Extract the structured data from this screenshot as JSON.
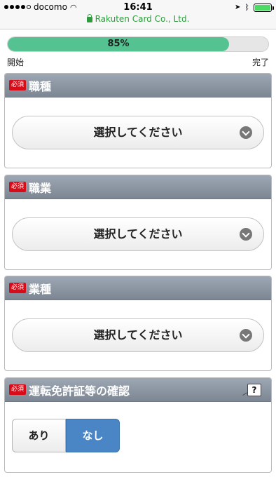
{
  "statusbar": {
    "carrier": "docomo",
    "time": "16:41"
  },
  "urlbar": {
    "site": "Rakuten Card Co., Ltd."
  },
  "progress": {
    "value": 85,
    "label": "85%",
    "start_label": "開始",
    "end_label": "完了"
  },
  "sections": [
    {
      "badge": "必須",
      "title": "職種",
      "select_label": "選択してください"
    },
    {
      "badge": "必須",
      "title": "職業",
      "select_label": "選択してください"
    },
    {
      "badge": "必須",
      "title": "業種",
      "select_label": "選択してください"
    },
    {
      "badge": "必須",
      "title": "運転免許証等の確認",
      "help_text": "?",
      "options": [
        "あり",
        "なし"
      ],
      "selected": "なし"
    }
  ],
  "colors": {
    "progress_fill": "#54c291",
    "badge": "#d80c18",
    "header": "#8b95a1",
    "toggle_selected": "#4a86c6"
  }
}
